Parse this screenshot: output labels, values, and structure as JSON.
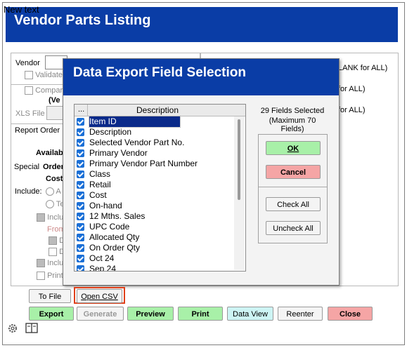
{
  "overlay_text": "New text",
  "window": {
    "title": "Vendor Parts Listing"
  },
  "form": {
    "vendor_label": "Vendor",
    "validate_label": "Validate",
    "compare_label": "Compar",
    "ver_label": "(Ve",
    "xls_file_label": "XLS File",
    "report_order_label": "Report Order I",
    "available_label": "Availab",
    "special_label": "Special",
    "order_label": "Order",
    "cost_label": "Cost",
    "include_label": "Include:",
    "radio_a": "A",
    "radio_t": "Te",
    "inclu_1": "Inclu",
    "from_label": "From",
    "d1": "D",
    "d2": "D",
    "inclu_2": "Inclu",
    "print_label": "Print",
    "right_hints": [
      "LANK for ALL)",
      "for ALL)",
      "for ALL)"
    ]
  },
  "dialog": {
    "title": "Data Export Field Selection",
    "col_dots": "...",
    "col_description": "Description",
    "fields_selected": "29 Fields Selected",
    "max_fields": "(Maximum 70 Fields)",
    "ok_label": "OK",
    "cancel_label": "Cancel",
    "check_all_label": "Check All",
    "uncheck_all_label": "Uncheck All",
    "items": [
      {
        "label": "Item ID",
        "checked": true
      },
      {
        "label": "Description",
        "checked": true
      },
      {
        "label": "Selected Vendor Part No.",
        "checked": true
      },
      {
        "label": "Primary Vendor",
        "checked": true
      },
      {
        "label": "Primary Vendor Part Number",
        "checked": true
      },
      {
        "label": "Class",
        "checked": true
      },
      {
        "label": "Retail",
        "checked": true
      },
      {
        "label": "Cost",
        "checked": true
      },
      {
        "label": "On-hand",
        "checked": true
      },
      {
        "label": "12 Mths. Sales",
        "checked": true
      },
      {
        "label": "UPC Code",
        "checked": true
      },
      {
        "label": "Allocated Qty",
        "checked": true
      },
      {
        "label": "On Order Qty",
        "checked": true
      },
      {
        "label": "Oct 24",
        "checked": true
      },
      {
        "label": "Sep 24",
        "checked": true
      }
    ]
  },
  "bottom": {
    "to_file_label": "To File",
    "open_csv_label": "Open CSV",
    "export_label": "Export",
    "generate_label": "Generate",
    "preview_label": "Preview",
    "print_label": "Print",
    "data_view_label": "Data View",
    "reenter_label": "Reenter",
    "close_label": "Close"
  },
  "colors": {
    "header_blue": "#0a3da6",
    "ok_green": "#a8f0a8",
    "cancel_red": "#f5a5a5",
    "highlight_red": "#e0401a",
    "check_blue": "#1a6fd6"
  },
  "icons": {
    "settings": "gear-icon",
    "book": "book-icon"
  }
}
